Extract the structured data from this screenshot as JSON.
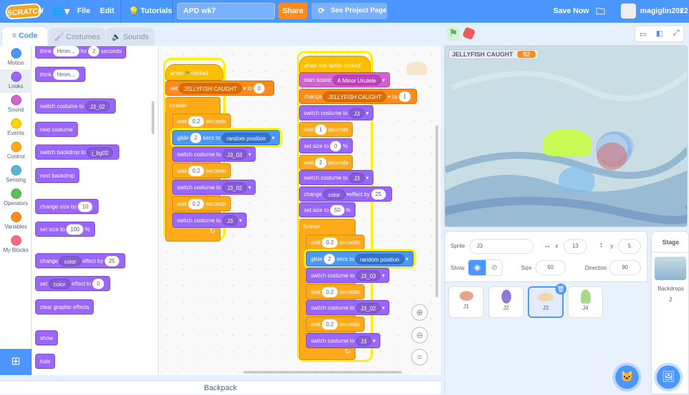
{
  "menu": {
    "logo": "SCRATCH",
    "file": "File",
    "edit": "Edit",
    "tutorials": "Tutorials",
    "project_title": "APD wk7",
    "share": "Share",
    "see_project": "See Project Page",
    "save_now": "Save Now",
    "username": "magiglin2022"
  },
  "tabs": {
    "code": "Code",
    "costumes": "Costumes",
    "sounds": "Sounds"
  },
  "categories": [
    {
      "label": "Motion",
      "color": "#4c97ff"
    },
    {
      "label": "Looks",
      "color": "#9966ff"
    },
    {
      "label": "Sound",
      "color": "#cf63cf"
    },
    {
      "label": "Events",
      "color": "#ffd500"
    },
    {
      "label": "Control",
      "color": "#ffab19"
    },
    {
      "label": "Sensing",
      "color": "#5cb1d6"
    },
    {
      "label": "Operators",
      "color": "#59c059"
    },
    {
      "label": "Variables",
      "color": "#ff8c1a"
    },
    {
      "label": "My Blocks",
      "color": "#ff6680"
    }
  ],
  "palette": {
    "think_for": {
      "a": "think",
      "v": "Hmm...",
      "b": "for",
      "n": "2",
      "c": "seconds"
    },
    "think": {
      "a": "think",
      "v": "Hmm..."
    },
    "switch_costume": {
      "a": "switch costume to",
      "v": "J3_02"
    },
    "next_costume": "next costume",
    "switch_backdrop": {
      "a": "switch backdrop to",
      "v": "j_bg02"
    },
    "next_backdrop": "next backdrop",
    "change_size": {
      "a": "change size by",
      "v": "10"
    },
    "set_size": {
      "a": "set size to",
      "v": "100",
      "b": "%"
    },
    "change_effect": {
      "a": "change",
      "v": "color",
      "b": "effect by",
      "n": "25"
    },
    "set_effect": {
      "a": "set",
      "v": "color",
      "b": "effect to",
      "n": "0"
    },
    "clear_effects": "clear graphic effects",
    "show": "show",
    "hide": "hide"
  },
  "script1": {
    "hat": {
      "a": "when",
      "b": "clicked"
    },
    "set": {
      "a": "set",
      "v": "JELLYFISH CAUGHT",
      "b": "to",
      "n": "0"
    },
    "forever": "forever",
    "wait1": {
      "a": "wait",
      "n": "0.2",
      "b": "seconds"
    },
    "glide": {
      "a": "glide",
      "n": "2",
      "b": "secs to",
      "v": "random position"
    },
    "sw1": {
      "a": "switch costume to",
      "v": "J3_03"
    },
    "wait2": {
      "a": "wait",
      "n": "0.2",
      "b": "seconds"
    },
    "sw2": {
      "a": "switch costume to",
      "v": "J3_02"
    },
    "wait3": {
      "a": "wait",
      "n": "0.2",
      "b": "seconds"
    },
    "sw3": {
      "a": "switch costume to",
      "v": "J3"
    }
  },
  "script2": {
    "hat": "when this sprite clicked",
    "sound": {
      "a": "start sound",
      "v": "A Minor Ukulele"
    },
    "change": {
      "a": "change",
      "v": "JELLYFISH CAUGHT",
      "b": "by",
      "n": "1"
    },
    "sw1": {
      "a": "switch costume to",
      "v": "J3"
    },
    "wait1": {
      "a": "wait",
      "n": "1",
      "b": "seconds"
    },
    "size1": {
      "a": "set size to",
      "n": "0",
      "b": "%"
    },
    "wait2": {
      "a": "wait",
      "n": "2",
      "b": "seconds"
    },
    "sw2": {
      "a": "switch costume to",
      "v": "J3"
    },
    "effect": {
      "a": "change",
      "v": "color",
      "b": "effect by",
      "n": "25"
    },
    "size2": {
      "a": "set size to",
      "n": "50",
      "b": "%"
    },
    "forever": "forever",
    "fw1": {
      "a": "wait",
      "n": "0.2",
      "b": "seconds"
    },
    "glide": {
      "a": "glide",
      "n": "2",
      "b": "secs to",
      "v": "random position"
    },
    "fsw1": {
      "a": "switch costume to",
      "v": "J3_03"
    },
    "fw2": {
      "a": "wait",
      "n": "0.2",
      "b": "seconds"
    },
    "fsw2": {
      "a": "switch costume to",
      "v": "J3_02"
    },
    "fw3": {
      "a": "wait",
      "n": "0.2",
      "b": "seconds"
    },
    "fsw3": {
      "a": "switch costume to",
      "v": "J3"
    }
  },
  "stage": {
    "var_name": "JELLYFISH CAUGHT",
    "var_value": "52"
  },
  "sprite_info": {
    "sprite_label": "Sprite",
    "sprite_name": "J3",
    "x_label": "x",
    "x": "13",
    "y_label": "y",
    "y": "5",
    "show_label": "Show",
    "size_label": "Size",
    "size": "50",
    "direction_label": "Direction",
    "direction": "90"
  },
  "sprites": [
    "J1",
    "J2",
    "J3",
    "J4"
  ],
  "stage_panel": {
    "title": "Stage",
    "backdrops_label": "Backdrops",
    "backdrops_count": "2"
  },
  "backpack": "Backpack"
}
